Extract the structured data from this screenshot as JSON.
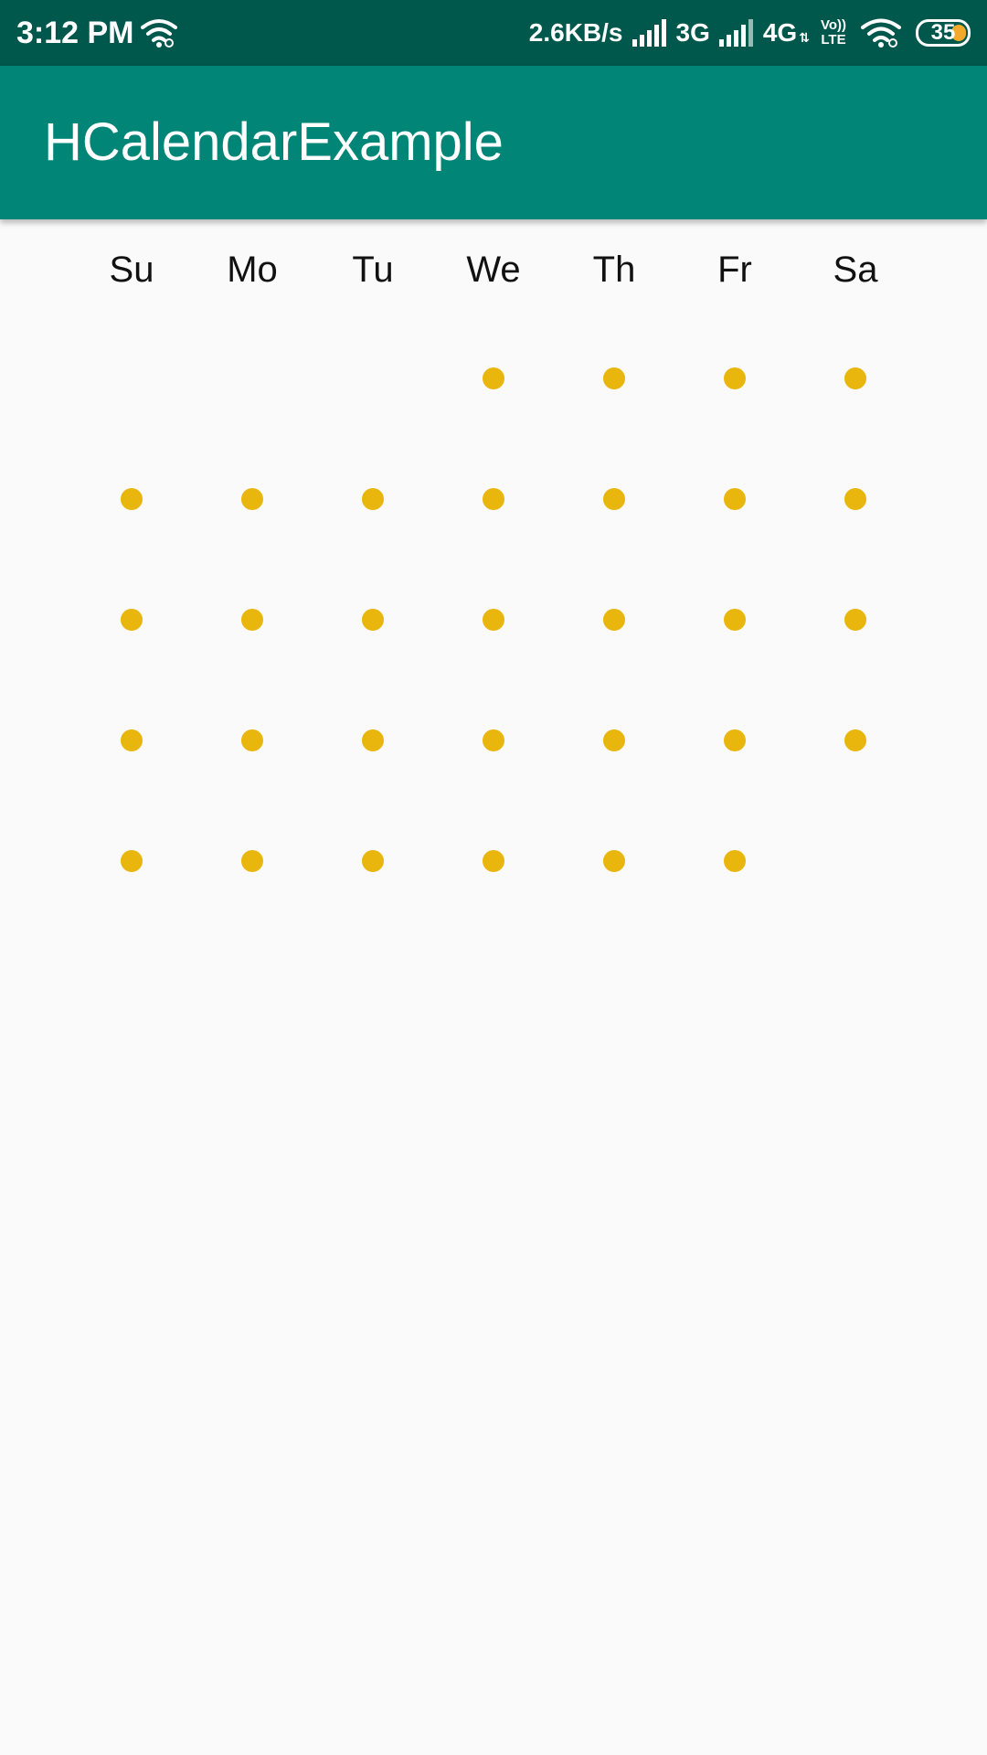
{
  "status_bar": {
    "time": "3:12 PM",
    "net_speed": "2.6KB/s",
    "network_1": "3G",
    "network_2": "4G",
    "volte_top": "Vo))",
    "volte_bottom": "LTE",
    "battery": "35",
    "battery_color": "#f3a92b",
    "icons": [
      "wifi-icon",
      "signal-icon",
      "signal-icon",
      "data-arrows-icon",
      "volte-icon",
      "wifi-icon",
      "battery-icon"
    ]
  },
  "app_bar": {
    "title": "HCalendarExample",
    "background": "#008577"
  },
  "calendar": {
    "weekdays": [
      "Su",
      "Mo",
      "Tu",
      "We",
      "Th",
      "Fr",
      "Sa"
    ],
    "dot_color": "#e9b60d",
    "weeks": [
      [
        false,
        false,
        false,
        true,
        true,
        true,
        true
      ],
      [
        true,
        true,
        true,
        true,
        true,
        true,
        true
      ],
      [
        true,
        true,
        true,
        true,
        true,
        true,
        true
      ],
      [
        true,
        true,
        true,
        true,
        true,
        true,
        true
      ],
      [
        true,
        true,
        true,
        true,
        true,
        true,
        false
      ]
    ]
  }
}
